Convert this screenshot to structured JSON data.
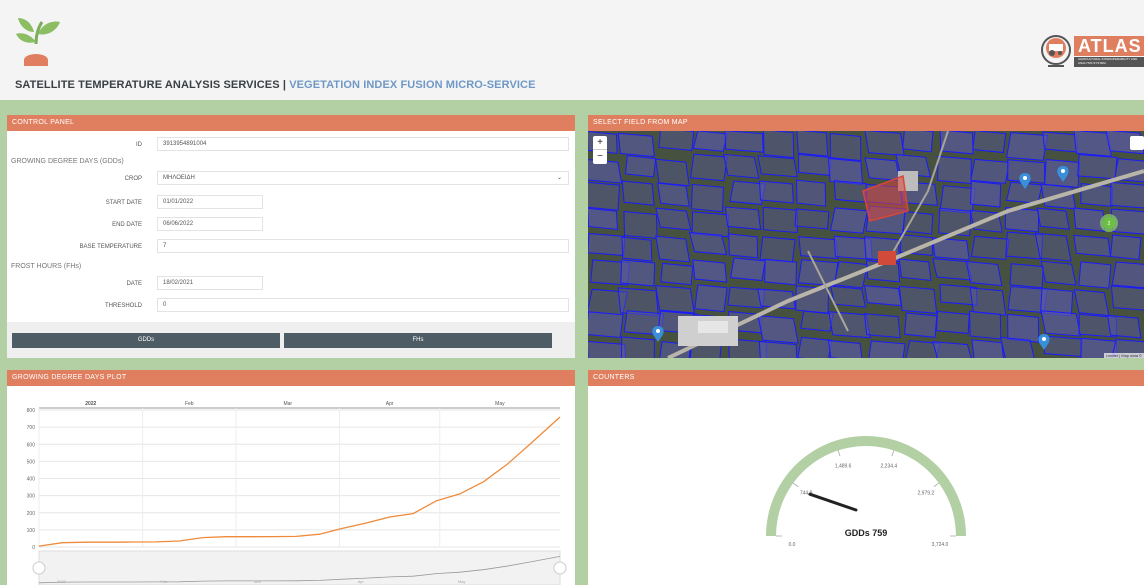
{
  "header": {
    "title_main": "SATELLITE TEMPERATURE ANALYSIS SERVICES",
    "title_sep": " | ",
    "title_sub": "VEGETATION INDEX FUSION MICRO-SERVICE",
    "logo_icon": "plant-sprout-icon",
    "brand": "ATLAS",
    "brand_tagline": "AGRICULTURAL INTEROPERABILITY AND ANALYSIS SYSTEM"
  },
  "control_panel": {
    "heading": "CONTROL PANEL",
    "id_label": "ID",
    "id_value": "3913954891004",
    "gdd_section": "GROWING DEGREE DAYS (GDDs)",
    "crop_label": "CROP",
    "crop_value": "ΜΗΛΟΕΙΔΗ",
    "start_label": "START DATE",
    "start_value": "01/01/2022",
    "end_label": "END DATE",
    "end_value": "06/06/2022",
    "base_label": "BASE TEMPERATURE",
    "base_value": "7",
    "fh_section": "FROST HOURS (FHs)",
    "date_label": "DATE",
    "date_value": "18/02/2021",
    "threshold_label": "THRESHOLD",
    "threshold_value": "0",
    "gdd_button": "GDDs",
    "fh_button": "FHs"
  },
  "map": {
    "heading": "SELECT FIELD FROM MAP",
    "zoom_in": "+",
    "zoom_out": "−",
    "attribution": "Leaflet | Map data ©",
    "cluster_count": "2",
    "colors": {
      "parcel_fill": "#5a5aa8",
      "parcel_stroke": "#1a1aff",
      "selected": "#d9463a",
      "marker": "#3a8fd9"
    }
  },
  "plot": {
    "heading": "GROWING DEGREE DAYS PLOT",
    "navigator_labels": [
      "2022",
      "Feb",
      "Mar",
      "Apr",
      "May"
    ]
  },
  "chart_data": {
    "type": "line",
    "title": "",
    "x_tick_labels": [
      "2022",
      "Feb",
      "Mar",
      "Apr",
      "May"
    ],
    "ylim": [
      0,
      800
    ],
    "y_ticks": [
      0,
      100,
      200,
      300,
      400,
      500,
      600,
      700,
      800
    ],
    "grid": true,
    "color": "#ef8a3a",
    "series": [
      {
        "x": [
          "2022-01-01",
          "2022-01-08",
          "2022-01-15",
          "2022-01-22",
          "2022-01-29",
          "2022-02-05",
          "2022-02-12",
          "2022-02-19",
          "2022-02-26",
          "2022-03-05",
          "2022-03-12",
          "2022-03-19",
          "2022-03-26",
          "2022-04-02",
          "2022-04-09",
          "2022-04-16",
          "2022-04-23",
          "2022-04-30",
          "2022-05-07",
          "2022-05-14",
          "2022-05-21",
          "2022-05-28",
          "2022-06-06"
        ],
        "y": [
          5,
          25,
          28,
          28,
          29,
          30,
          35,
          55,
          60,
          60,
          61,
          62,
          75,
          110,
          140,
          175,
          195,
          270,
          310,
          380,
          480,
          600,
          759
        ]
      }
    ]
  },
  "counters": {
    "heading": "COUNTERS",
    "gauge_label": "GDDs",
    "gauge_value": "759",
    "gauge_ticks": [
      "0.0",
      "744.8",
      "1,489.6",
      "2,234.4",
      "2,979.2",
      "3,724.0"
    ],
    "gauge_value_num": 759,
    "gauge_max": 3724,
    "gauge_color": "#b3cfa4"
  }
}
